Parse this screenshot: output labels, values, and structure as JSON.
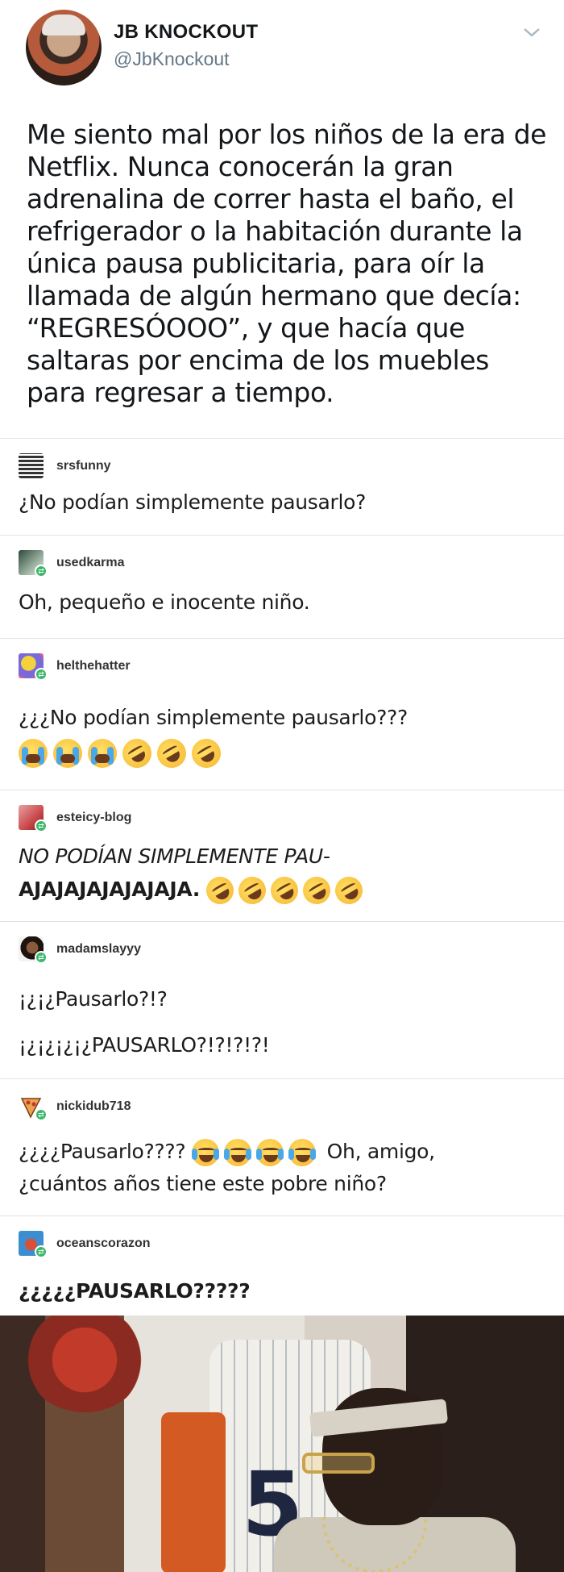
{
  "tweet": {
    "name": "JB KNOCKOUT",
    "handle": "@JbKnockout",
    "text": "Me siento mal por los niños de la era de Netflix. Nunca conocerán la gran adrenalina de correr hasta el baño, el refrigerador o la habitación durante la única pausa publicitaria, para oír la llamada de algún hermano que decía: “REGRESÓOOO”, y que hacía que saltaras por encima de los muebles para regresar a tiempo.",
    "menu_icon": "chevron-down-icon"
  },
  "entries": [
    {
      "username": "srsfunny",
      "lines": [
        "¿No podían simplemente pausarlo?"
      ]
    },
    {
      "username": "usedkarma",
      "lines": [
        "Oh, pequeño e inocente niño."
      ]
    },
    {
      "username": "helthehatter",
      "lines": [
        "¿¿¿No podían simplemente pausarlo???"
      ],
      "emojis": [
        "loudly-crying-face",
        "loudly-crying-face",
        "loudly-crying-face",
        "rolling-on-floor-laughing",
        "rolling-on-floor-laughing",
        "rolling-on-floor-laughing"
      ]
    },
    {
      "username": "esteicy-blog",
      "lines": [
        "NO PODÍAN SIMPLEMENTE PAU-",
        "AJAJAJAJAJAJAJA."
      ],
      "emojis": [
        "rolling-on-floor-laughing",
        "rolling-on-floor-laughing",
        "rolling-on-floor-laughing",
        "rolling-on-floor-laughing",
        "rolling-on-floor-laughing"
      ]
    },
    {
      "username": "madamslayyy",
      "lines": [
        "¡¿¡¿Pausarlo?!?",
        "¡¿¡¿¡¿¡¿PAUSARLO?!?!?!?!"
      ]
    },
    {
      "username": "nickidub718",
      "lines": [
        "¿¿¿¿Pausarlo????",
        "Oh, amigo,",
        "¿cuántos años tiene este pobre niño?"
      ],
      "emojis": [
        "face-with-tears-of-joy",
        "face-with-tears-of-joy",
        "face-with-tears-of-joy",
        "face-with-tears-of-joy"
      ]
    },
    {
      "username": "oceanscorazon",
      "lines": [
        "¿¿¿¿¿PAUSARLO?????"
      ]
    }
  ],
  "reblog_icon": "reblog-icon",
  "colors": {
    "reblog_badge": "#3cb86a",
    "handle": "#657786"
  }
}
